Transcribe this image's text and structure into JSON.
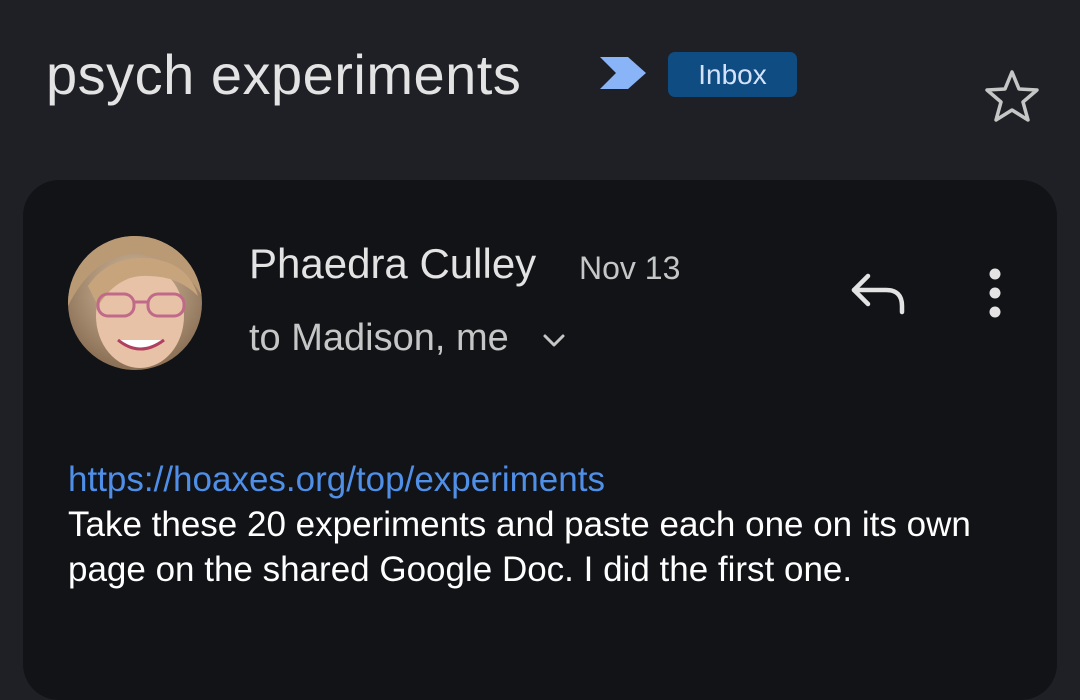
{
  "thread": {
    "subject": "psych experiments",
    "label": "Inbox"
  },
  "icons": {
    "importance": "importance-marker-icon",
    "star": "star-icon",
    "reply": "reply-icon",
    "more": "more-vert-icon",
    "expand": "chevron-down-icon"
  },
  "message": {
    "sender": "Phaedra Culley",
    "date": "Nov 13",
    "recipients": "to Madison, me",
    "link": "https://hoaxes.org/top/experiments",
    "body": "Take these 20 experiments and paste each one on its own page on the shared Google Doc. I did the first one."
  },
  "colors": {
    "background": "#1e2025",
    "card": "#111317",
    "chip": "#0f4c81",
    "link": "#4f8fe8",
    "importance": "#8ab4f8"
  }
}
